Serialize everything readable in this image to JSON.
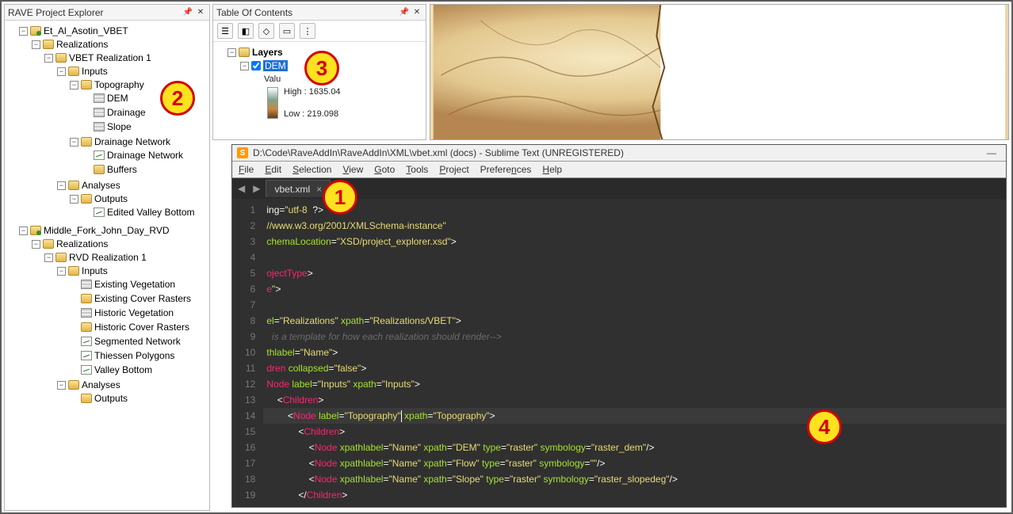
{
  "rave": {
    "title": "RAVE Project Explorer",
    "tree": {
      "p1": "Et_Al_Asotin_VBET",
      "p1_real": "Realizations",
      "p1_r1": "VBET Realization 1",
      "p1_inputs": "Inputs",
      "p1_topo": "Topography",
      "p1_dem": "DEM",
      "p1_drain": "Drainage",
      "p1_slope": "Slope",
      "p1_dnet": "Drainage Network",
      "p1_dnet2": "Drainage Network",
      "p1_buf": "Buffers",
      "p1_an": "Analyses",
      "p1_out": "Outputs",
      "p1_evb": "Edited Valley Bottom",
      "p2": "Middle_Fork_John_Day_RVD",
      "p2_real": "Realizations",
      "p2_r1": "RVD Realization 1",
      "p2_inputs": "Inputs",
      "p2_ev": "Existing Vegetation",
      "p2_ecr": "Existing Cover Rasters",
      "p2_hv": "Historic Vegetation",
      "p2_hcr": "Historic Cover Rasters",
      "p2_sn": "Segmented Network",
      "p2_tp": "Thiessen Polygons",
      "p2_vb": "Valley Bottom",
      "p2_an": "Analyses",
      "p2_out": "Outputs"
    }
  },
  "toc": {
    "title": "Table Of Contents",
    "layers": "Layers",
    "dem": "DEM",
    "value": "Valu",
    "high": "High : 1635.04",
    "low": "Low : 219.098"
  },
  "subl": {
    "title": "D:\\Code\\RaveAddIn\\RaveAddIn\\XML\\vbet.xml (docs) - Sublime Text (UNREGISTERED)",
    "menu": [
      "File",
      "Edit",
      "Selection",
      "View",
      "Goto",
      "Tools",
      "Project",
      "Preferences",
      "Help"
    ],
    "tab": "vbet.xml",
    "lines": [
      {
        "n": 1,
        "html": "<span class='s-txt'>ing=</span><span class='s-str'>\"utf-8&nbsp;&nbsp;</span><span class='s-txt'>?&gt;</span>"
      },
      {
        "n": 2,
        "html": "<span class='s-str'>//www.w3.org/2001/XMLSchema-instance\"</span>"
      },
      {
        "n": 3,
        "html": "<span class='s-attr'>chemaLocation</span><span class='s-op'>=</span><span class='s-str'>\"XSD/project_explorer.xsd\"</span><span class='s-txt'>&gt;</span>"
      },
      {
        "n": 4,
        "html": ""
      },
      {
        "n": 5,
        "html": "<span class='s-tag'>ojectType</span><span class='s-txt'>&gt;</span>"
      },
      {
        "n": 6,
        "html": "<span class='s-tag'>e</span><span class='s-str'>\"</span><span class='s-txt'>&gt;</span>"
      },
      {
        "n": 7,
        "html": ""
      },
      {
        "n": 8,
        "html": "<span class='s-attr'>el</span><span class='s-op'>=</span><span class='s-str'>\"Realizations\"</span> <span class='s-attr'>xpath</span><span class='s-op'>=</span><span class='s-str'>\"Realizations/VBET\"</span><span class='s-txt'>&gt;</span>"
      },
      {
        "n": 9,
        "html": "<span class='s-cmt'>  is a template for how each realization should render--&gt;</span>"
      },
      {
        "n": 10,
        "html": "<span class='s-attr'>thlabel</span><span class='s-op'>=</span><span class='s-str'>\"Name\"</span><span class='s-txt'>&gt;</span>"
      },
      {
        "n": 11,
        "html": "<span class='s-tag'>dren</span> <span class='s-attr'>collapsed</span><span class='s-op'>=</span><span class='s-str'>\"false\"</span><span class='s-txt'>&gt;</span>"
      },
      {
        "n": 12,
        "html": "<span class='s-tag'>Node</span> <span class='s-attr'>label</span><span class='s-op'>=</span><span class='s-str'>\"Inputs\"</span> <span class='s-attr'>xpath</span><span class='s-op'>=</span><span class='s-str'>\"Inputs\"</span><span class='s-txt'>&gt;</span>"
      },
      {
        "n": 13,
        "html": "&nbsp;&nbsp;&nbsp;&nbsp;<span class='s-txt'>&lt;</span><span class='s-tag'>Children</span><span class='s-txt'>&gt;</span>"
      },
      {
        "n": 14,
        "html": "&nbsp;&nbsp;&nbsp;&nbsp;&nbsp;&nbsp;&nbsp;&nbsp;<span class='s-txt'>&lt;</span><span class='s-tag'>Node</span> <span class='s-attr'>label</span><span class='s-op'>=</span><span class='s-str'>\"Topography\"</span><span class='cursor'></span> <span class='s-attr'>xpath</span><span class='s-op'>=</span><span class='s-str'>\"Topography\"</span><span class='s-txt'>&gt;</span>",
        "hl": true
      },
      {
        "n": 15,
        "html": "&nbsp;&nbsp;&nbsp;&nbsp;&nbsp;&nbsp;&nbsp;&nbsp;&nbsp;&nbsp;&nbsp;&nbsp;<span class='s-txt'>&lt;</span><span class='s-tag'>Children</span><span class='s-txt'>&gt;</span>"
      },
      {
        "n": 16,
        "html": "&nbsp;&nbsp;&nbsp;&nbsp;&nbsp;&nbsp;&nbsp;&nbsp;&nbsp;&nbsp;&nbsp;&nbsp;&nbsp;&nbsp;&nbsp;&nbsp;<span class='s-txt'>&lt;</span><span class='s-tag'>Node</span> <span class='s-attr'>xpathlabel</span><span class='s-op'>=</span><span class='s-str'>\"Name\"</span> <span class='s-attr'>xpath</span><span class='s-op'>=</span><span class='s-str'>\"DEM\"</span> <span class='s-attr'>type</span><span class='s-op'>=</span><span class='s-str'>\"raster\"</span> <span class='s-attr'>symbology</span><span class='s-op'>=</span><span class='s-str'>\"raster_dem\"</span><span class='s-txt'>/&gt;</span>"
      },
      {
        "n": 17,
        "html": "&nbsp;&nbsp;&nbsp;&nbsp;&nbsp;&nbsp;&nbsp;&nbsp;&nbsp;&nbsp;&nbsp;&nbsp;&nbsp;&nbsp;&nbsp;&nbsp;<span class='s-txt'>&lt;</span><span class='s-tag'>Node</span> <span class='s-attr'>xpathlabel</span><span class='s-op'>=</span><span class='s-str'>\"Name\"</span> <span class='s-attr'>xpath</span><span class='s-op'>=</span><span class='s-str'>\"Flow\"</span> <span class='s-attr'>type</span><span class='s-op'>=</span><span class='s-str'>\"raster\"</span> <span class='s-attr'>symbology</span><span class='s-op'>=</span><span class='s-str'>\"\"</span><span class='s-txt'>/&gt;</span>"
      },
      {
        "n": 18,
        "html": "&nbsp;&nbsp;&nbsp;&nbsp;&nbsp;&nbsp;&nbsp;&nbsp;&nbsp;&nbsp;&nbsp;&nbsp;&nbsp;&nbsp;&nbsp;&nbsp;<span class='s-txt'>&lt;</span><span class='s-tag'>Node</span> <span class='s-attr'>xpathlabel</span><span class='s-op'>=</span><span class='s-str'>\"Name\"</span> <span class='s-attr'>xpath</span><span class='s-op'>=</span><span class='s-str'>\"Slope\"</span> <span class='s-attr'>type</span><span class='s-op'>=</span><span class='s-str'>\"raster\"</span> <span class='s-attr'>symbology</span><span class='s-op'>=</span><span class='s-str'>\"raster_slopedeg\"</span><span class='s-txt'>/&gt;</span>"
      },
      {
        "n": 19,
        "html": "&nbsp;&nbsp;&nbsp;&nbsp;&nbsp;&nbsp;&nbsp;&nbsp;&nbsp;&nbsp;&nbsp;&nbsp;<span class='s-txt'>&lt;/</span><span class='s-tag'>Children</span><span class='s-txt'>&gt;</span>"
      }
    ]
  },
  "badges": {
    "b1": "1",
    "b2": "2",
    "b3": "3",
    "b4": "4"
  }
}
